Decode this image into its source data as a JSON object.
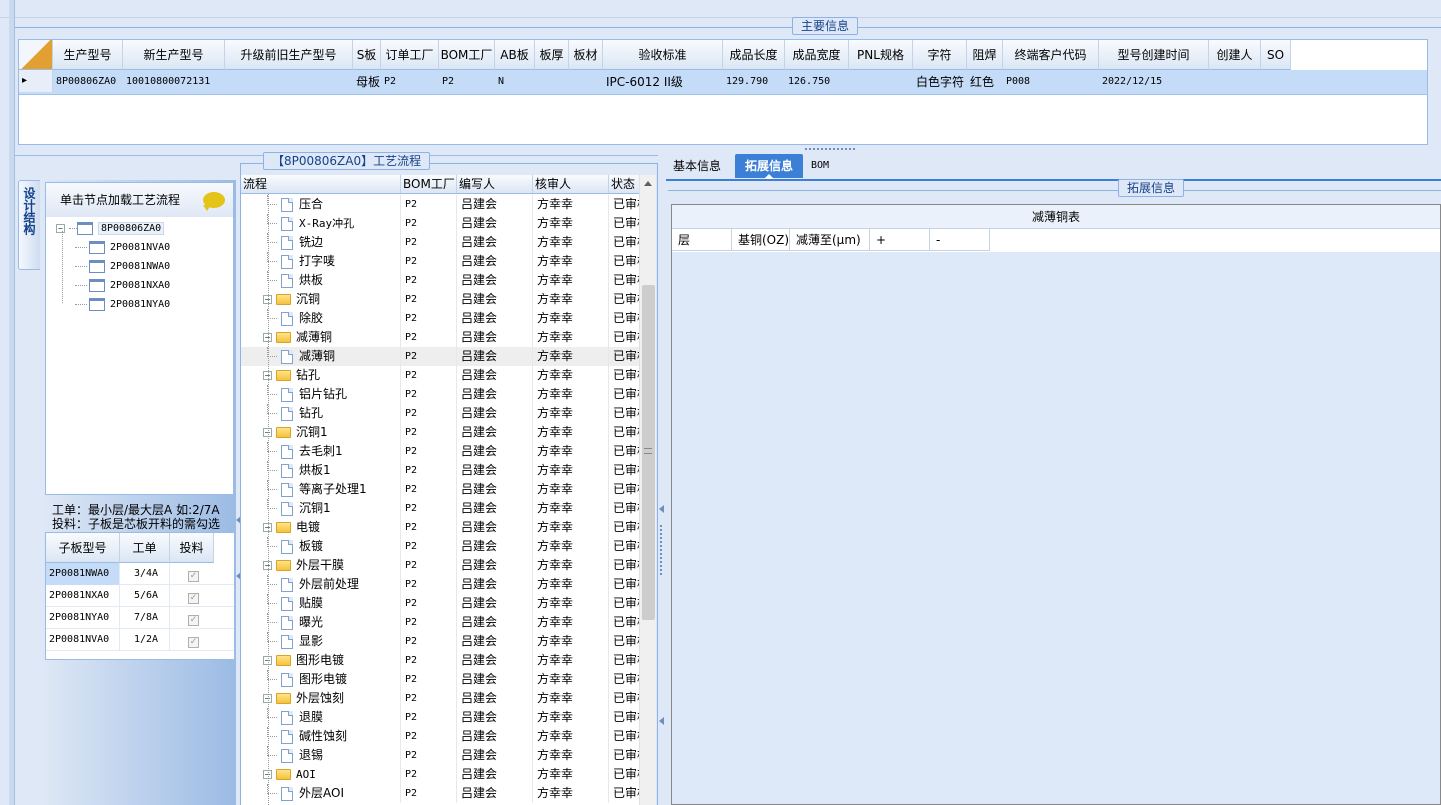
{
  "main_info": {
    "title": "主要信息",
    "columns": [
      "生产型号",
      "新生产型号",
      "升级前旧生产型号",
      "S板",
      "订单工厂",
      "BOM工厂",
      "AB板",
      "板厚",
      "板材",
      "验收标准",
      "成品长度",
      "成品宽度",
      "PNL规格",
      "字符",
      "阻焊",
      "终端客户代码",
      "型号创建时间",
      "创建人",
      "SO"
    ],
    "row": [
      "8P00806ZA0",
      "10010800072131",
      "",
      "母板",
      "P2",
      "P2",
      "N",
      "",
      "",
      "IPC-6012 II级",
      "129.790",
      "126.750",
      "",
      "白色字符",
      "红色",
      "P008",
      "2022/12/15",
      "",
      ""
    ],
    "row_marker": "▸"
  },
  "left_panel": {
    "vertical_tab": "设计结构",
    "hint": "单击节点加载工艺流程",
    "tree_root": "8P00806ZA0",
    "tree_children": [
      "2P0081NVA0",
      "2P0081NWA0",
      "2P0081NXA0",
      "2P0081NYA0"
    ],
    "note_line1": "工单：最小层/最大层A 如:2/7A",
    "note_line2": "投料：子板是芯板开料的需勾选",
    "sub_columns": [
      "子板型号",
      "工单",
      "投料"
    ],
    "sub_rows": [
      {
        "model": "2P0081NWA0",
        "order": "3/4A",
        "checked": "✓"
      },
      {
        "model": "2P0081NXA0",
        "order": "5/6A",
        "checked": "✓"
      },
      {
        "model": "2P0081NYA0",
        "order": "7/8A",
        "checked": "✓"
      },
      {
        "model": "2P0081NVA0",
        "order": "1/2A",
        "checked": "✓"
      }
    ]
  },
  "flow_panel": {
    "title": "【8P00806ZA0】工艺流程",
    "columns": [
      "流程",
      "BOM工厂",
      "编写人",
      "核审人",
      "状态"
    ],
    "rows": [
      {
        "name": "压合",
        "folder": false,
        "factory": "P2",
        "writer": "吕建会",
        "reviewer": "方幸幸",
        "status": "已审核"
      },
      {
        "name": "X-Ray冲孔",
        "folder": false,
        "factory": "P2",
        "writer": "吕建会",
        "reviewer": "方幸幸",
        "status": "已审核"
      },
      {
        "name": "铣边",
        "folder": false,
        "factory": "P2",
        "writer": "吕建会",
        "reviewer": "方幸幸",
        "status": "已审核"
      },
      {
        "name": "打字唛",
        "folder": false,
        "factory": "P2",
        "writer": "吕建会",
        "reviewer": "方幸幸",
        "status": "已审核"
      },
      {
        "name": "烘板",
        "folder": false,
        "factory": "P2",
        "writer": "吕建会",
        "reviewer": "方幸幸",
        "status": "已审核"
      },
      {
        "name": "沉铜",
        "folder": true,
        "factory": "P2",
        "writer": "吕建会",
        "reviewer": "方幸幸",
        "status": "已审核"
      },
      {
        "name": "除胶",
        "folder": false,
        "factory": "P2",
        "writer": "吕建会",
        "reviewer": "方幸幸",
        "status": "已审核"
      },
      {
        "name": "减薄铜",
        "folder": true,
        "factory": "P2",
        "writer": "吕建会",
        "reviewer": "方幸幸",
        "status": "已审核"
      },
      {
        "name": "减薄铜",
        "folder": false,
        "factory": "P2",
        "writer": "吕建会",
        "reviewer": "方幸幸",
        "status": "已审核"
      },
      {
        "name": "钻孔",
        "folder": true,
        "factory": "P2",
        "writer": "吕建会",
        "reviewer": "方幸幸",
        "status": "已审核"
      },
      {
        "name": "铝片钻孔",
        "folder": false,
        "factory": "P2",
        "writer": "吕建会",
        "reviewer": "方幸幸",
        "status": "已审核"
      },
      {
        "name": "钻孔",
        "folder": false,
        "factory": "P2",
        "writer": "吕建会",
        "reviewer": "方幸幸",
        "status": "已审核"
      },
      {
        "name": "沉铜1",
        "folder": true,
        "factory": "P2",
        "writer": "吕建会",
        "reviewer": "方幸幸",
        "status": "已审核"
      },
      {
        "name": "去毛刺1",
        "folder": false,
        "factory": "P2",
        "writer": "吕建会",
        "reviewer": "方幸幸",
        "status": "已审核"
      },
      {
        "name": "烘板1",
        "folder": false,
        "factory": "P2",
        "writer": "吕建会",
        "reviewer": "方幸幸",
        "status": "已审核"
      },
      {
        "name": "等离子处理1",
        "folder": false,
        "factory": "P2",
        "writer": "吕建会",
        "reviewer": "方幸幸",
        "status": "已审核"
      },
      {
        "name": "沉铜1",
        "folder": false,
        "factory": "P2",
        "writer": "吕建会",
        "reviewer": "方幸幸",
        "status": "已审核"
      },
      {
        "name": "电镀",
        "folder": true,
        "factory": "P2",
        "writer": "吕建会",
        "reviewer": "方幸幸",
        "status": "已审核"
      },
      {
        "name": "板镀",
        "folder": false,
        "factory": "P2",
        "writer": "吕建会",
        "reviewer": "方幸幸",
        "status": "已审核"
      },
      {
        "name": "外层干膜",
        "folder": true,
        "factory": "P2",
        "writer": "吕建会",
        "reviewer": "方幸幸",
        "status": "已审核"
      },
      {
        "name": "外层前处理",
        "folder": false,
        "factory": "P2",
        "writer": "吕建会",
        "reviewer": "方幸幸",
        "status": "已审核"
      },
      {
        "name": "贴膜",
        "folder": false,
        "factory": "P2",
        "writer": "吕建会",
        "reviewer": "方幸幸",
        "status": "已审核"
      },
      {
        "name": "曝光",
        "folder": false,
        "factory": "P2",
        "writer": "吕建会",
        "reviewer": "方幸幸",
        "status": "已审核"
      },
      {
        "name": "显影",
        "folder": false,
        "factory": "P2",
        "writer": "吕建会",
        "reviewer": "方幸幸",
        "status": "已审核"
      },
      {
        "name": "图形电镀",
        "folder": true,
        "factory": "P2",
        "writer": "吕建会",
        "reviewer": "方幸幸",
        "status": "已审核"
      },
      {
        "name": "图形电镀",
        "folder": false,
        "factory": "P2",
        "writer": "吕建会",
        "reviewer": "方幸幸",
        "status": "已审核"
      },
      {
        "name": "外层蚀刻",
        "folder": true,
        "factory": "P2",
        "writer": "吕建会",
        "reviewer": "方幸幸",
        "status": "已审核"
      },
      {
        "name": "退膜",
        "folder": false,
        "factory": "P2",
        "writer": "吕建会",
        "reviewer": "方幸幸",
        "status": "已审核"
      },
      {
        "name": "碱性蚀刻",
        "folder": false,
        "factory": "P2",
        "writer": "吕建会",
        "reviewer": "方幸幸",
        "status": "已审核"
      },
      {
        "name": "退锡",
        "folder": false,
        "factory": "P2",
        "writer": "吕建会",
        "reviewer": "方幸幸",
        "status": "已审核"
      },
      {
        "name": "AOI",
        "folder": true,
        "factory": "P2",
        "writer": "吕建会",
        "reviewer": "方幸幸",
        "status": "已审核"
      },
      {
        "name": "外层AOI",
        "folder": false,
        "factory": "P2",
        "writer": "吕建会",
        "reviewer": "方幸幸",
        "status": "已审核"
      }
    ]
  },
  "right_panel": {
    "tabs": [
      "基本信息",
      "拓展信息",
      "BOM"
    ],
    "active_tab": "拓展信息",
    "group_title": "拓展信息",
    "table_title": "减薄铜表",
    "columns": [
      "层",
      "基铜(OZ)",
      "减薄至(μm)",
      "+",
      "-"
    ]
  },
  "colors": {
    "accent": "#3c7fd6",
    "header_bg": "#dbe6f4",
    "selected_row": "#c4dcf8",
    "panel_bg": "#dfe8f6"
  }
}
